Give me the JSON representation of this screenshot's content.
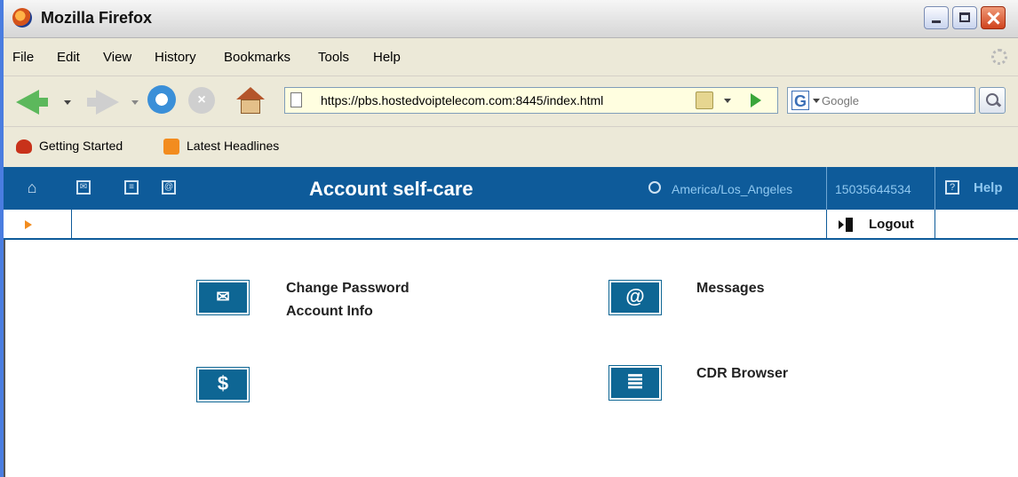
{
  "window": {
    "title": "Mozilla Firefox"
  },
  "menu": [
    "File",
    "Edit",
    "View",
    "History",
    "Bookmarks",
    "Tools",
    "Help"
  ],
  "nav": {
    "url": "https://pbs.hostedvoiptelecom.com:8445/index.html",
    "search_placeholder": "Google"
  },
  "bookmarks": [
    "Getting Started",
    "Latest Headlines"
  ],
  "portal": {
    "title": "Account self-care",
    "timezone": "America/Los_Angeles",
    "account": "15035644534",
    "help": "Help",
    "logout": "Logout"
  },
  "tiles": [
    {
      "icon": "envelope-icon",
      "lines": [
        "Change Password",
        "Account Info"
      ]
    },
    {
      "icon": "at-sign-icon",
      "lines": [
        "Messages"
      ]
    },
    {
      "icon": "dollar-icon",
      "lines": []
    },
    {
      "icon": "list-icon",
      "lines": [
        "CDR Browser"
      ]
    }
  ],
  "colors": {
    "portal_bar": "#0e5b9a",
    "link": "#8fc8f0"
  }
}
